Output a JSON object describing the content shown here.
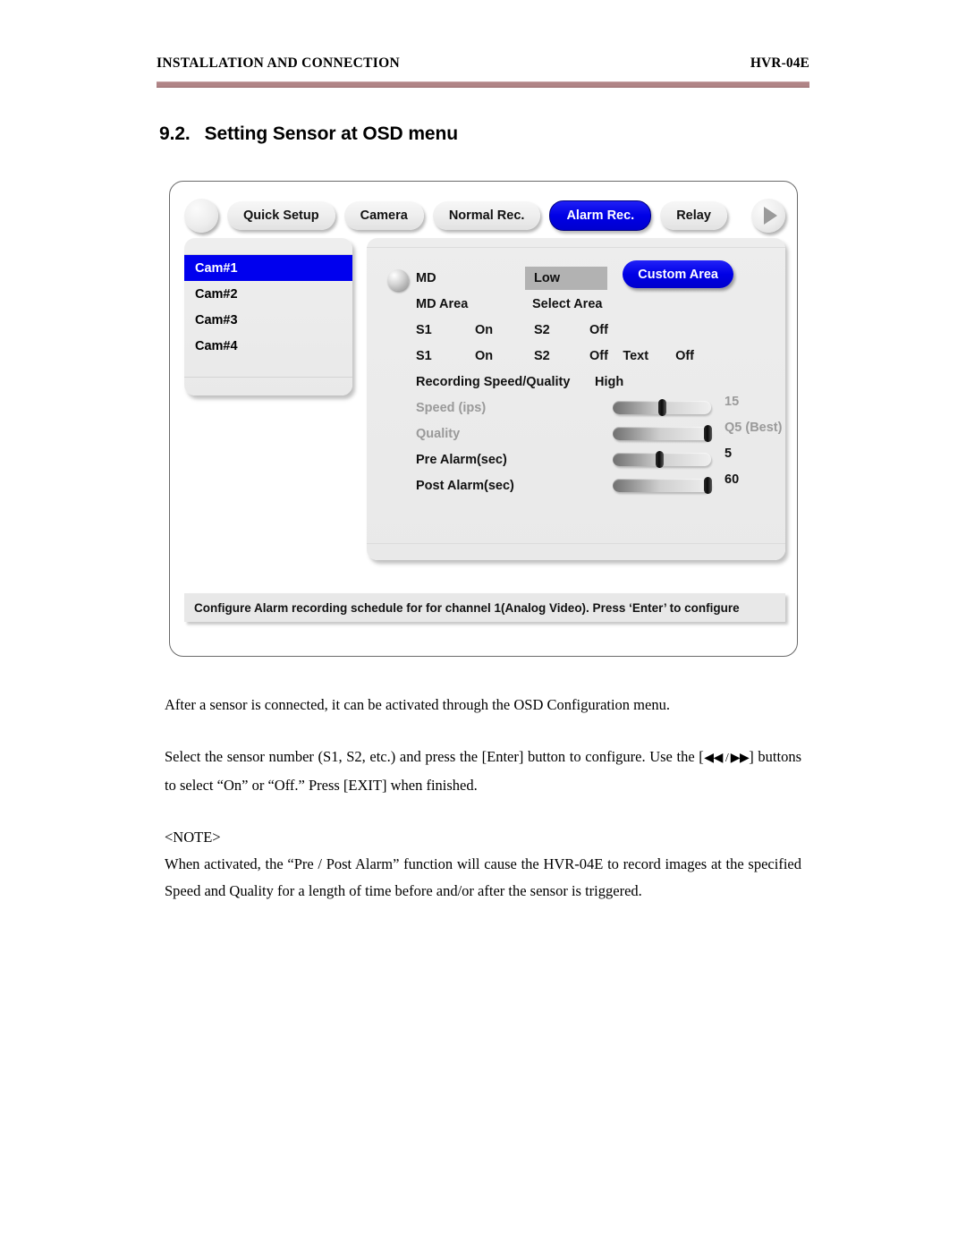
{
  "header": {
    "left": "INSTALLATION AND CONNECTION",
    "right": "HVR-04E",
    "rule_color": "#b08486"
  },
  "section": {
    "number": "9.2.",
    "title": "Setting Sensor at OSD menu"
  },
  "osd": {
    "nav": {
      "prev_icon": "circle-blank-icon",
      "next_icon": "triangle-right-icon"
    },
    "tabs": [
      {
        "label": "Quick Setup",
        "active": false
      },
      {
        "label": "Camera",
        "active": false
      },
      {
        "label": "Normal Rec.",
        "active": false
      },
      {
        "label": "Alarm Rec.",
        "active": true
      },
      {
        "label": "Relay",
        "active": false
      }
    ],
    "active_tab_color": "#0000ee",
    "camera_list": [
      {
        "label": "Cam#1",
        "selected": true
      },
      {
        "label": "Cam#2",
        "selected": false
      },
      {
        "label": "Cam#3",
        "selected": false
      },
      {
        "label": "Cam#4",
        "selected": false
      }
    ],
    "settings": {
      "md_label": "MD",
      "md_value": "Low",
      "md_area_label": "MD Area",
      "select_area_label": "Select Area",
      "custom_area_button": "Custom Area",
      "sensor_row_1": {
        "s1_label": "S1",
        "s1_value": "On",
        "s2_label": "S2",
        "s2_value": "Off"
      },
      "sensor_row_2": {
        "s1_label": "S1",
        "s1_value": "On",
        "s2_label": "S2",
        "s2_value": "Off"
      },
      "text_label": "Text",
      "text_value": "Off",
      "recording_label": "Recording Speed/Quality",
      "recording_value": "High",
      "sliders": [
        {
          "label": "Speed (ips)",
          "value": "15",
          "percent": 46,
          "dim": true
        },
        {
          "label": "Quality",
          "value": "Q5 (Best)",
          "percent": 93,
          "dim": true
        },
        {
          "label": "Pre Alarm(sec)",
          "value": "5",
          "percent": 44,
          "dim": false
        },
        {
          "label": "Post Alarm(sec)",
          "value": "60",
          "percent": 93,
          "dim": false
        }
      ]
    },
    "status_text": "Configure Alarm recording schedule for for channel 1(Analog Video). Press ‘Enter’ to configure"
  },
  "body": {
    "p1": "After a sensor is connected, it can be activated through the OSD Configuration menu.",
    "p2_before": "Select the sensor number (S1, S2, etc.) and press the [Enter] button to configure. Use the [",
    "p2_arrows": "◀◀ / ▶▶",
    "p2_after": "] buttons to select “On” or “Off.” Press [EXIT] when finished.",
    "p3": "<NOTE>",
    "p4": "When activated, the “Pre / Post Alarm” function will cause the HVR-04E to record images at the specified Speed and Quality for a length of time before and/or after the sensor is triggered."
  }
}
